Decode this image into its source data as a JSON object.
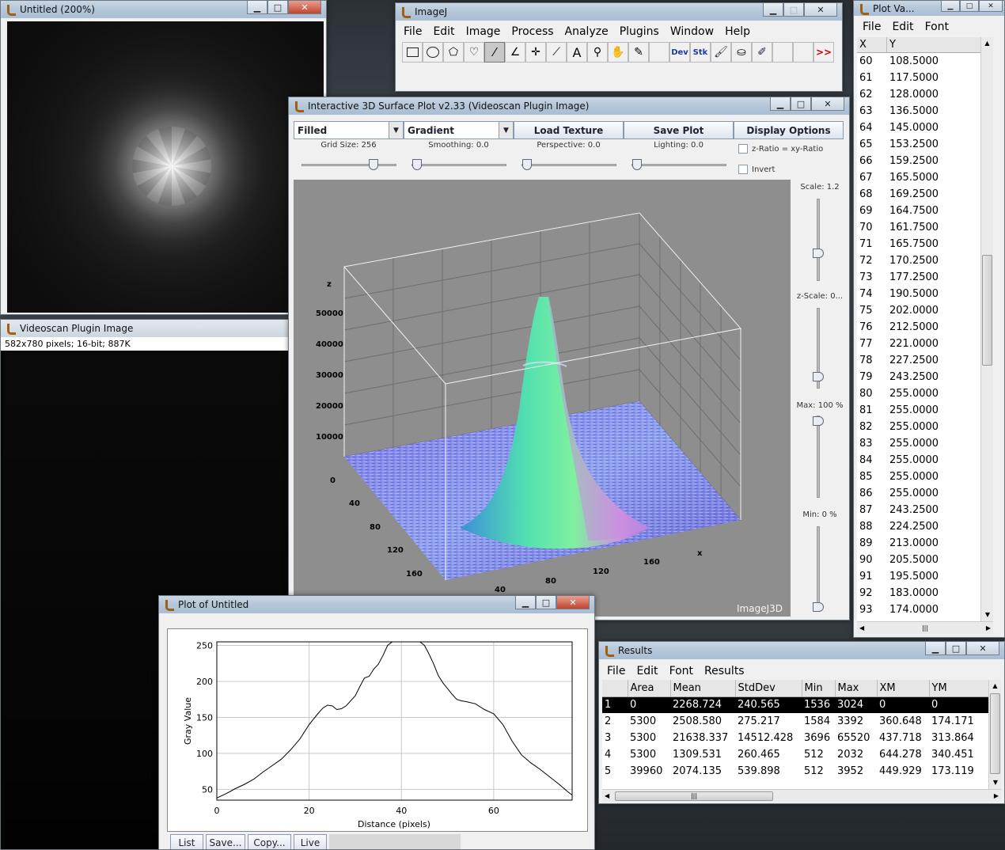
{
  "untitled_window": {
    "title": "Untitled (200%)"
  },
  "videoscan_window": {
    "title": "Videoscan Plugin Image",
    "info": "582x780 pixels; 16-bit; 887K"
  },
  "imagej": {
    "title": "ImageJ",
    "menu": [
      "File",
      "Edit",
      "Image",
      "Process",
      "Analyze",
      "Plugins",
      "Window",
      "Help"
    ],
    "tools": [
      "rectangle-icon",
      "oval-icon",
      "polygon-icon",
      "freehand-icon",
      "line-icon",
      "angle-icon",
      "point-icon",
      "wand-icon",
      "text-icon",
      "magnifier-icon",
      "hand-icon",
      "dropper-icon",
      "dev-icon",
      "stk-icon",
      "brush-icon",
      "flood-fill-icon",
      "pencil-icon",
      "blank-icon",
      "blank-icon",
      "more-icon"
    ],
    "dev_label": "Dev",
    "stk_label": "Stk",
    "more_label": ">>"
  },
  "surface": {
    "title": "Interactive 3D Surface Plot v2.33  (Videoscan Plugin Image)",
    "mode_select": "Filled",
    "color_select": "Gradient",
    "load_texture": "Load Texture",
    "save_plot": "Save Plot",
    "display_options": "Display Options",
    "grid_label": "Grid Size: 256",
    "smoothing_label": "Smoothing: 0.0",
    "perspective_label": "Perspective: 0.0",
    "lighting_label": "Lighting: 0.0",
    "zratio_label": "z-Ratio = xy-Ratio",
    "invert_label": "Invert",
    "scale_label": "Scale: 1.2",
    "zscale_label": "z-Scale: 0...",
    "max_label": "Max: 100 %",
    "min_label": "Min: 0 %",
    "watermark": "ImageJ3D",
    "z_axis": "z",
    "z_ticks": [
      "50000",
      "40000",
      "30000",
      "20000",
      "10000",
      "0"
    ],
    "y_ticks": [
      "40",
      "80",
      "120",
      "160"
    ],
    "x_ticks": [
      "40",
      "80",
      "120",
      "160"
    ],
    "x_axis": "x"
  },
  "plot_values": {
    "title": "Plot Va...",
    "menu": [
      "File",
      "Edit",
      "Font"
    ],
    "headers": [
      "X",
      "Y"
    ],
    "rows": [
      [
        "60",
        "108.5000"
      ],
      [
        "61",
        "117.5000"
      ],
      [
        "62",
        "128.0000"
      ],
      [
        "63",
        "136.5000"
      ],
      [
        "64",
        "145.0000"
      ],
      [
        "65",
        "153.2500"
      ],
      [
        "66",
        "159.2500"
      ],
      [
        "67",
        "165.5000"
      ],
      [
        "68",
        "169.2500"
      ],
      [
        "69",
        "164.7500"
      ],
      [
        "70",
        "161.7500"
      ],
      [
        "71",
        "165.7500"
      ],
      [
        "72",
        "170.2500"
      ],
      [
        "73",
        "177.2500"
      ],
      [
        "74",
        "190.5000"
      ],
      [
        "75",
        "202.0000"
      ],
      [
        "76",
        "212.5000"
      ],
      [
        "77",
        "221.0000"
      ],
      [
        "78",
        "227.2500"
      ],
      [
        "79",
        "243.2500"
      ],
      [
        "80",
        "255.0000"
      ],
      [
        "81",
        "255.0000"
      ],
      [
        "82",
        "255.0000"
      ],
      [
        "83",
        "255.0000"
      ],
      [
        "84",
        "255.0000"
      ],
      [
        "85",
        "255.0000"
      ],
      [
        "86",
        "255.0000"
      ],
      [
        "87",
        "243.2500"
      ],
      [
        "88",
        "224.2500"
      ],
      [
        "89",
        "213.0000"
      ],
      [
        "90",
        "205.5000"
      ],
      [
        "91",
        "195.5000"
      ],
      [
        "92",
        "183.0000"
      ],
      [
        "93",
        "174.0000"
      ]
    ]
  },
  "plot_window": {
    "title": "Plot of Untitled",
    "buttons": [
      "List",
      "Save...",
      "Copy...",
      "Live"
    ]
  },
  "chart_data": {
    "type": "line",
    "title": "",
    "xlabel": "Distance (pixels)",
    "ylabel": "Gray Value",
    "xlim": [
      0,
      77
    ],
    "ylim": [
      35,
      255
    ],
    "x_ticks": [
      "0",
      "20",
      "40",
      "60"
    ],
    "y_ticks": [
      "50",
      "100",
      "150",
      "200",
      "250"
    ],
    "grid": true,
    "series": [
      {
        "x": [
          0,
          2,
          4,
          6,
          8,
          10,
          12,
          14,
          16,
          18,
          20,
          22,
          23,
          24,
          25,
          26,
          27,
          28,
          30,
          31,
          32,
          33,
          34,
          35,
          36,
          37,
          38,
          39,
          40,
          41,
          42,
          43,
          44,
          45,
          46,
          47,
          48,
          49,
          50,
          51,
          52,
          53,
          54,
          56,
          58,
          60,
          62,
          64,
          66,
          68,
          70,
          72,
          74,
          76,
          77
        ],
        "y": [
          38,
          44,
          51,
          57,
          64,
          74,
          83,
          92,
          105,
          120,
          140,
          156,
          163,
          167,
          166,
          161,
          162,
          166,
          180,
          193,
          205,
          207,
          217,
          224,
          236,
          250,
          255,
          255,
          255,
          255,
          255,
          255,
          255,
          250,
          238,
          224,
          208,
          198,
          190,
          182,
          175,
          173,
          172,
          169,
          161,
          155,
          140,
          117,
          98,
          87,
          78,
          68,
          58,
          47,
          42
        ]
      }
    ]
  },
  "results": {
    "title": "Results",
    "menu": [
      "File",
      "Edit",
      "Font",
      "Results"
    ],
    "headers": [
      "",
      "Area",
      "Mean",
      "StdDev",
      "Min",
      "Max",
      "XM",
      "YM"
    ],
    "rows": [
      [
        "1",
        "0",
        "2268.724",
        "240.565",
        "1536",
        "3024",
        "0",
        "0"
      ],
      [
        "2",
        "5300",
        "2508.580",
        "275.217",
        "1584",
        "3392",
        "360.648",
        "174.171"
      ],
      [
        "3",
        "5300",
        "21638.337",
        "14512.428",
        "3696",
        "65520",
        "437.718",
        "313.864"
      ],
      [
        "4",
        "5300",
        "1309.531",
        "260.465",
        "512",
        "2032",
        "644.278",
        "340.451"
      ],
      [
        "5",
        "39960",
        "2074.135",
        "539.898",
        "512",
        "3952",
        "449.929",
        "173.119"
      ]
    ]
  }
}
